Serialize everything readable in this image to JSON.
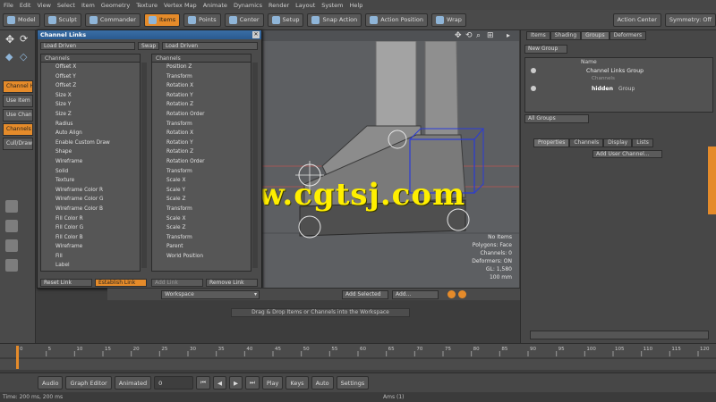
{
  "menu": [
    "File",
    "Edit",
    "View",
    "Select",
    "Item",
    "Geometry",
    "Texture",
    "Vertex Map",
    "Animate",
    "Dynamics",
    "Render",
    "Layout",
    "System",
    "Help"
  ],
  "toolbar": {
    "buttons": [
      "Model",
      "Sculpt",
      "Commander",
      "Items",
      "Points",
      "Center",
      "Setup",
      "Snap Action",
      "Action Position",
      "Wrap"
    ],
    "active": "Items",
    "right": [
      "Action Center",
      "Symmetry: Off"
    ]
  },
  "left_tools": [
    "Channel Haul",
    "Use Item",
    "Use Channel",
    "Channels",
    "Cull/Draw"
  ],
  "channel_window": {
    "title": "Channel Links",
    "load_driven_label": "Load Driven",
    "swap_label": "Swap",
    "load_driver_label": "Load Driven",
    "left_header": "Channels",
    "right_header": "Channels",
    "left_channels": [
      "Offset X",
      "Offset Y",
      "Offset Z",
      "Size X",
      "Size Y",
      "Size Z",
      "Radius",
      "Auto Align",
      "Enable Custom Draw",
      "Shape",
      "Wireframe",
      "Solid",
      "Texture",
      "Wireframe Color R",
      "Wireframe Color G",
      "Wireframe Color B",
      "Fill Color R",
      "Fill Color G",
      "Fill Color B",
      "Wireframe",
      "Fill",
      "Label"
    ],
    "right_channels": [
      "Position Z",
      "Transform",
      "Rotation X",
      "Rotation Y",
      "Rotation Z",
      "Rotation Order",
      "Transform",
      "Rotation X",
      "Rotation Y",
      "Rotation Z",
      "Rotation Order",
      "Transform",
      "Scale X",
      "Scale Y",
      "Scale Z",
      "Transform",
      "Scale X",
      "Scale Z",
      "Transform",
      "Parent",
      "World Position"
    ],
    "footer": [
      "Reset Link",
      "Establish Link",
      "Add Link",
      "Remove Link"
    ]
  },
  "viewport": {
    "info_lines": [
      "No Items",
      "Polygons: Face",
      "Channels: 0",
      "Deformers: ON",
      "GL: 1,580",
      "100 mm"
    ],
    "hint": "Drag & Drop Items or Channels into the Workspace",
    "workspace_label": "Workspace",
    "add_selected": "Add Selected",
    "add": "Add..."
  },
  "watermark": "www.cgtsj.com",
  "right_panel": {
    "tabs_top": [
      "Items",
      "Shading",
      "Groups",
      "Deformers"
    ],
    "new_group": "New Group",
    "name_header": "Name",
    "groups": [
      {
        "name": "Channel Links Group",
        "sub": "Channels"
      },
      {
        "name": "hidden",
        "sub": "Group"
      }
    ],
    "filter": "All Groups",
    "tabs_bottom": [
      "Properties",
      "Channels",
      "Display",
      "Lists"
    ],
    "add_channel": "Add User Channel..."
  },
  "timeline": {
    "ticks_top": [
      "0",
      "5",
      "10",
      "15",
      "20",
      "25",
      "30",
      "35",
      "40",
      "45",
      "50",
      "55",
      "60",
      "65",
      "70",
      "75",
      "80",
      "85",
      "90",
      "95",
      "100",
      "105",
      "110",
      "115",
      "120"
    ]
  },
  "transport": [
    "Audio",
    "Graph Editor",
    "Animated",
    "0",
    "Play",
    "Keys",
    "Auto",
    "Settings"
  ],
  "status": {
    "left": "Time: 200 ms, 200 ms",
    "mid": "Ams (1)"
  },
  "colors": {
    "accent": "#e58b2a",
    "watermark": "#ffef00",
    "title": "#3a6ea5"
  }
}
